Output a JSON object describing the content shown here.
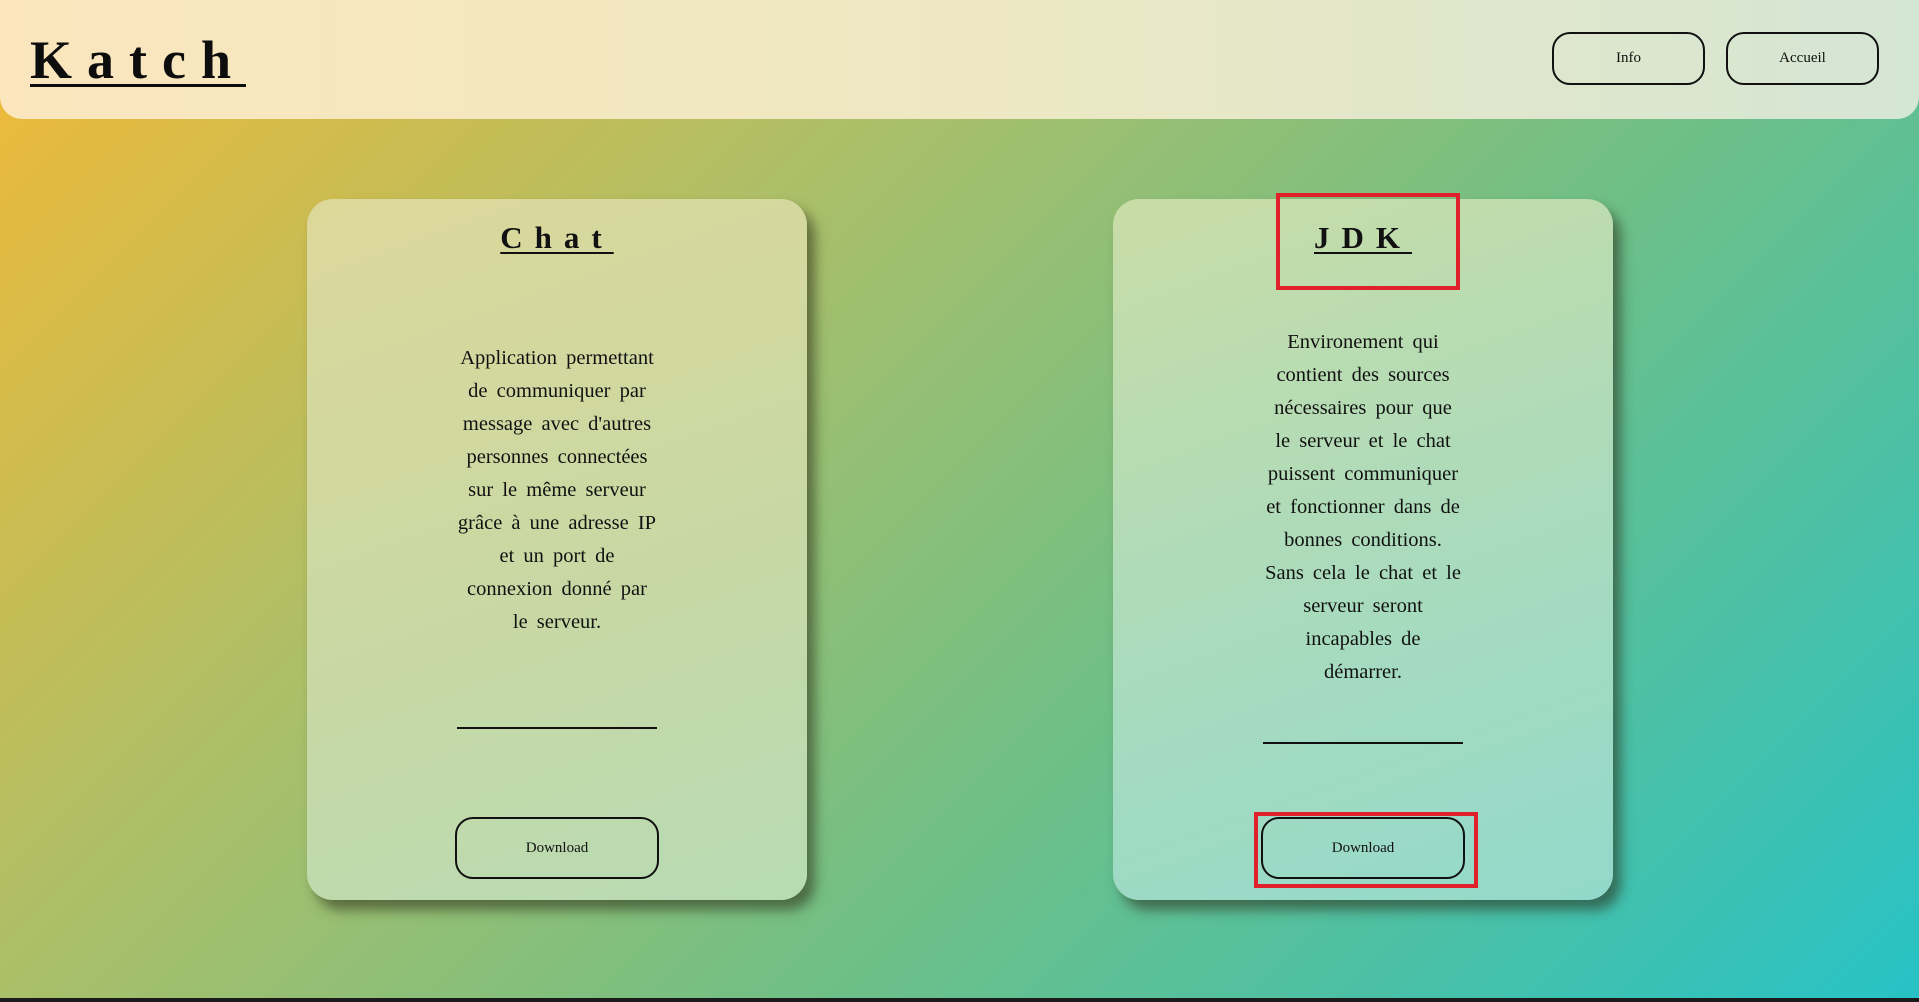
{
  "header": {
    "logo": "Katch",
    "nav": {
      "info_label": "Info",
      "accueil_label": "Accueil"
    }
  },
  "cards": [
    {
      "title": "Chat",
      "description": "Application permettant de communiquer par message avec d'autres personnes connectées sur le même serveur grâce à une adresse IP et un port de connexion donné par le serveur.",
      "download_label": "Download"
    },
    {
      "title": "JDK",
      "description": "Environement qui contient des sources nécessaires pour que le serveur et le chat puissent communiquer et fonctionner dans de bonnes conditions. Sans cela le chat et le serveur seront incapables de démarrer.",
      "download_label": "Download"
    }
  ],
  "colors": {
    "highlight": "#e0202a",
    "bg_start": "#f2b936",
    "bg_end": "#27c2c6"
  }
}
